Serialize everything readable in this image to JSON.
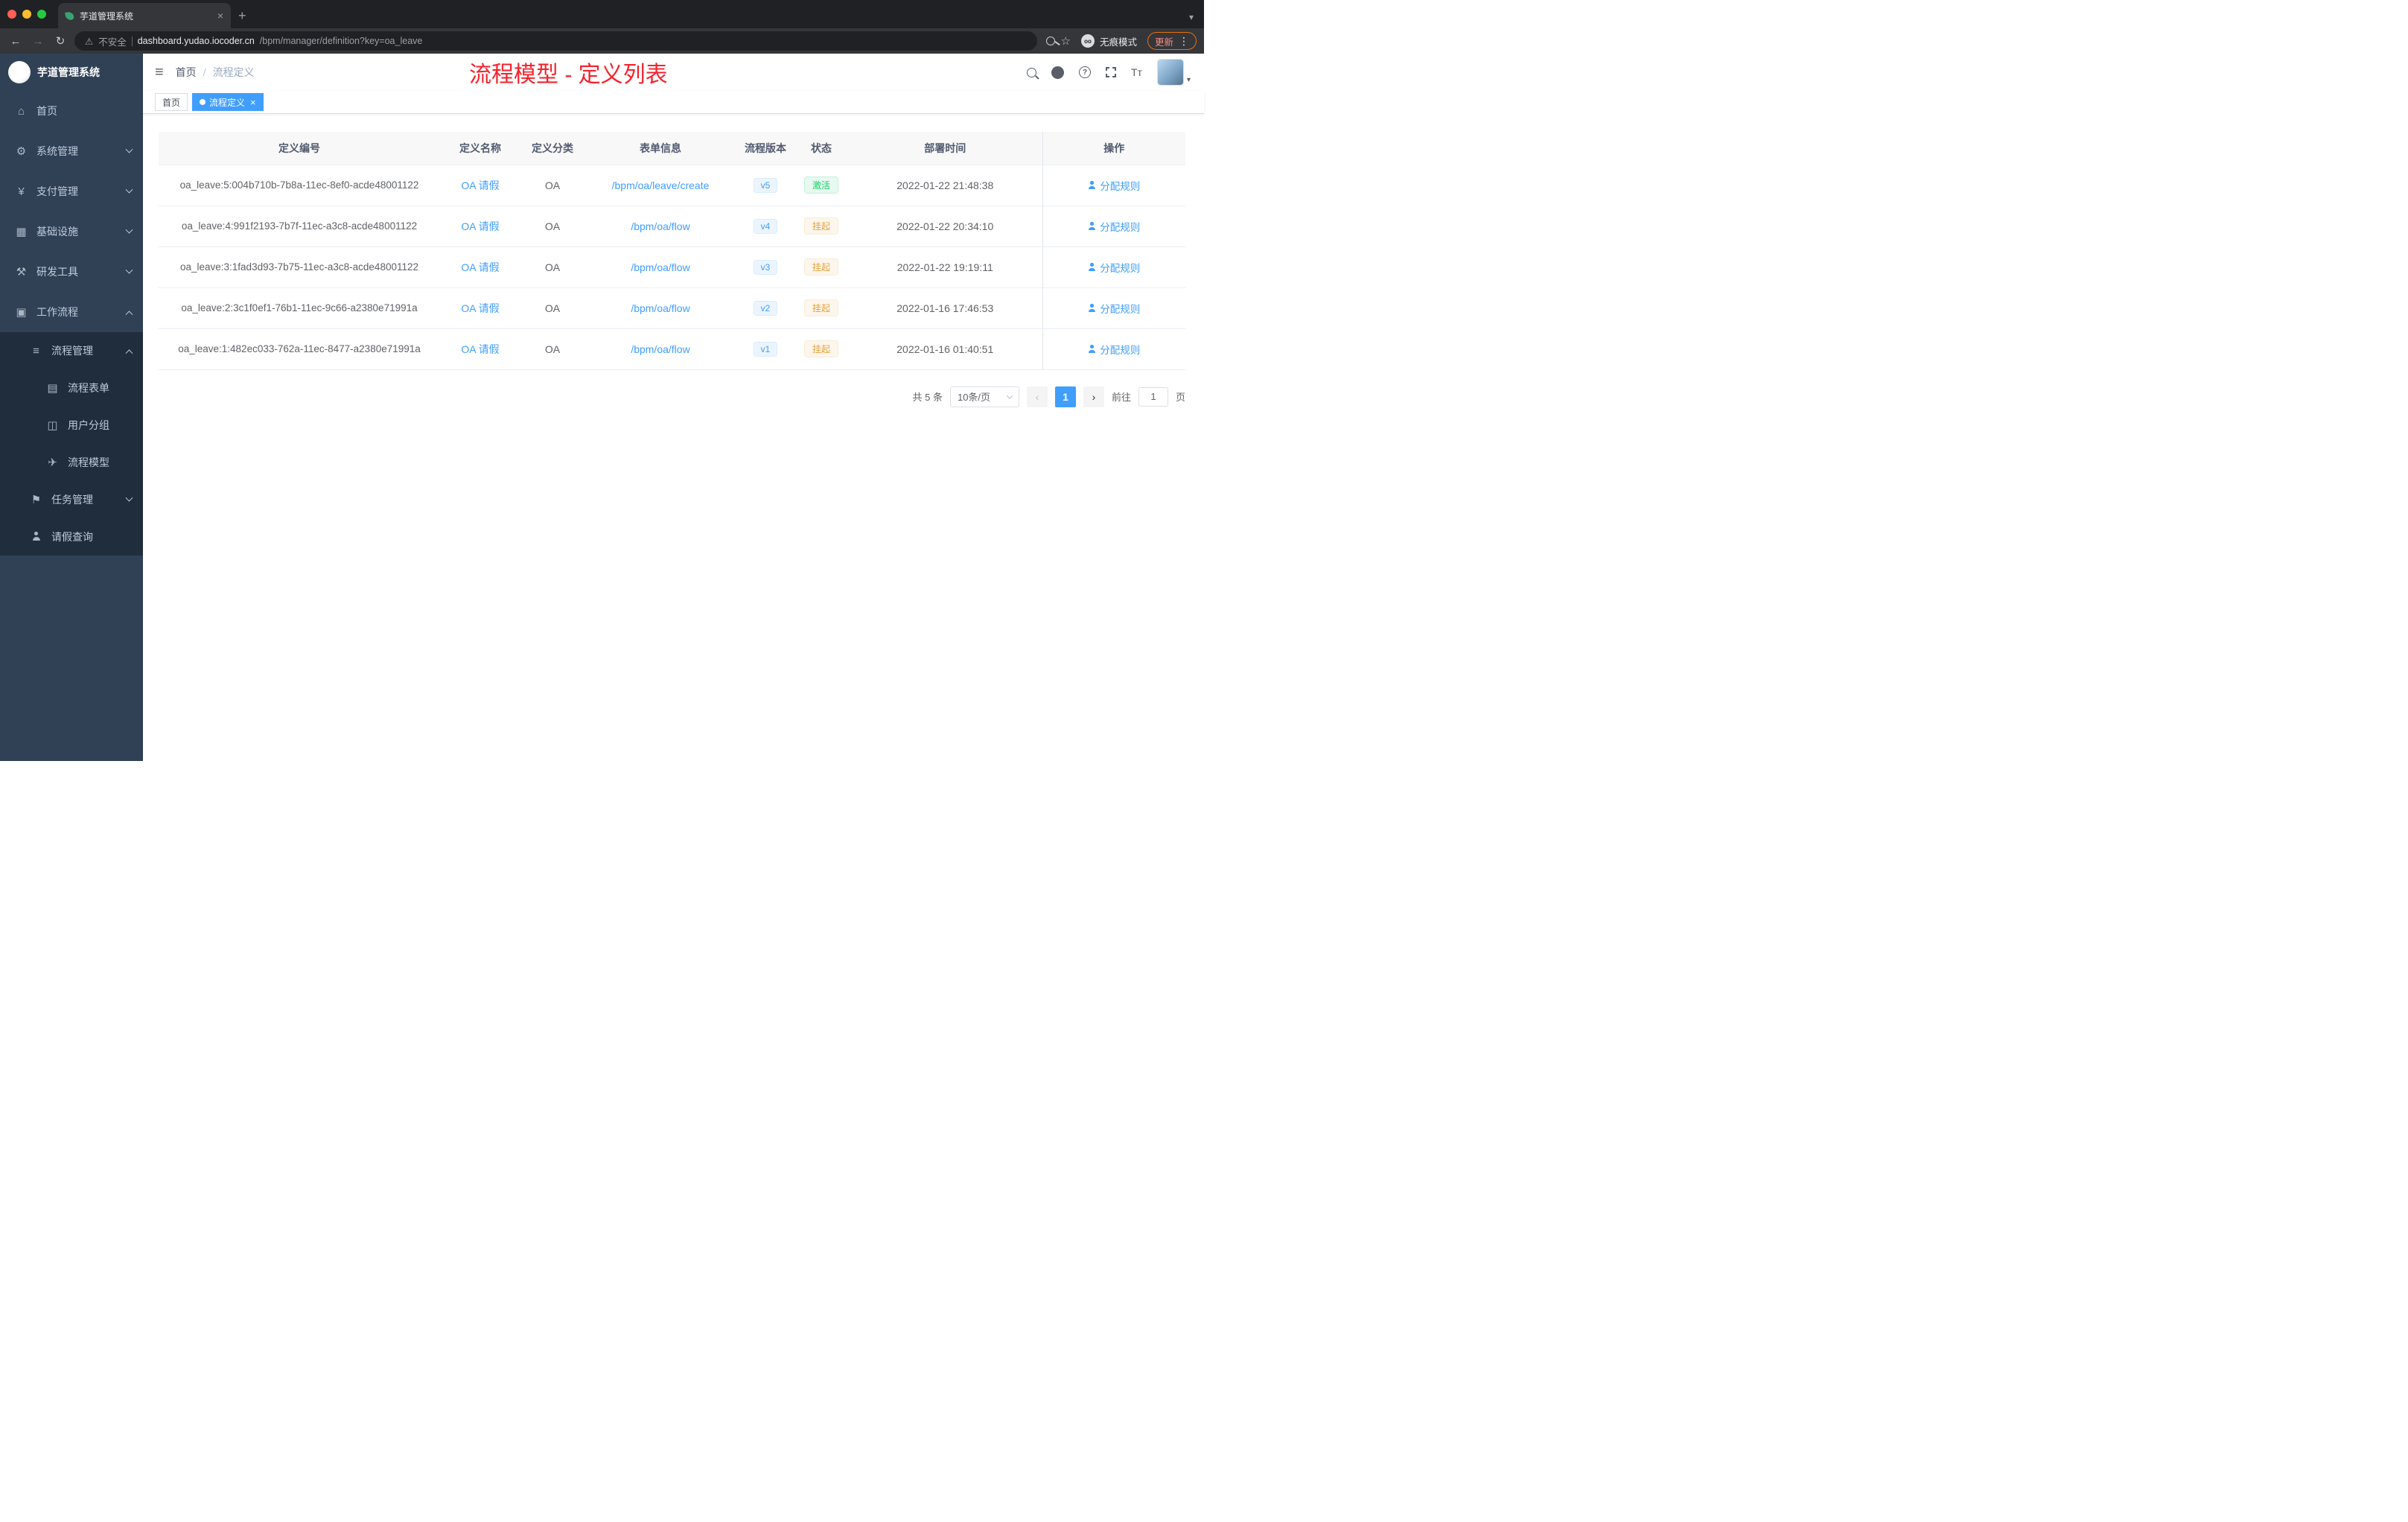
{
  "browser": {
    "tab_title": "芋道管理系统",
    "security_label": "不安全",
    "url_host": "dashboard.yudao.iocoder.cn",
    "url_path": "/bpm/manager/definition?key=oa_leave",
    "incognito_label": "无痕模式",
    "update_label": "更新"
  },
  "icons": {
    "close": "×",
    "plus": "+",
    "back": "←",
    "forward": "→",
    "reload": "↻",
    "warning": "⚠",
    "star": "☆",
    "menu_dots": "⋮",
    "hamburger": "≡",
    "question": "?",
    "font_size": "Tт",
    "chevron_left": "‹",
    "chevron_right": "›",
    "breadcrumb_sep": "/",
    "caret_down": "▾",
    "incognito_glasses": "oo"
  },
  "colors": {
    "accent": "#409eff",
    "annotation_red": "#f5222d",
    "status_active_green": "#13ce66",
    "status_suspend_orange": "#e6a23c",
    "sidebar_bg": "#304156",
    "submenu_bg": "#1f2d3d"
  },
  "sidebar": {
    "brand": "芋道管理系统",
    "items": [
      {
        "label": "首页",
        "icon": "⌂"
      },
      {
        "label": "系统管理",
        "icon": "⚙"
      },
      {
        "label": "支付管理",
        "icon": "¥"
      },
      {
        "label": "基础设施",
        "icon": "▦"
      },
      {
        "label": "研发工具",
        "icon": "⚒"
      },
      {
        "label": "工作流程",
        "icon": "▣"
      },
      {
        "label": "流程管理",
        "icon": "≡"
      },
      {
        "label": "流程表单",
        "icon": "▤"
      },
      {
        "label": "用户分组",
        "icon": "◫"
      },
      {
        "label": "流程模型",
        "icon": "✈"
      },
      {
        "label": "任务管理",
        "icon": "⚑"
      },
      {
        "label": "请假查询",
        "icon": ""
      }
    ]
  },
  "header": {
    "breadcrumb": [
      "首页",
      "流程定义"
    ],
    "annotation": "流程模型 - 定义列表"
  },
  "tags": {
    "items": [
      {
        "label": "首页"
      },
      {
        "label": "流程定义"
      }
    ]
  },
  "table": {
    "headers": [
      "定义编号",
      "定义名称",
      "定义分类",
      "表单信息",
      "流程版本",
      "状态",
      "部署时间",
      "操作"
    ],
    "action_label": "分配规则",
    "rows": [
      {
        "id": "oa_leave:5:004b710b-7b8a-11ec-8ef0-acde48001122",
        "name": "OA 请假",
        "category": "OA",
        "form": "/bpm/oa/leave/create",
        "version": "v5",
        "status": "激活",
        "status_type": "success",
        "time": "2022-01-22 21:48:38"
      },
      {
        "id": "oa_leave:4:991f2193-7b7f-11ec-a3c8-acde48001122",
        "name": "OA 请假",
        "category": "OA",
        "form": "/bpm/oa/flow",
        "version": "v4",
        "status": "挂起",
        "status_type": "warning",
        "time": "2022-01-22 20:34:10"
      },
      {
        "id": "oa_leave:3:1fad3d93-7b75-11ec-a3c8-acde48001122",
        "name": "OA 请假",
        "category": "OA",
        "form": "/bpm/oa/flow",
        "version": "v3",
        "status": "挂起",
        "status_type": "warning",
        "time": "2022-01-22 19:19:11"
      },
      {
        "id": "oa_leave:2:3c1f0ef1-76b1-11ec-9c66-a2380e71991a",
        "name": "OA 请假",
        "category": "OA",
        "form": "/bpm/oa/flow",
        "version": "v2",
        "status": "挂起",
        "status_type": "warning",
        "time": "2022-01-16 17:46:53"
      },
      {
        "id": "oa_leave:1:482ec033-762a-11ec-8477-a2380e71991a",
        "name": "OA 请假",
        "category": "OA",
        "form": "/bpm/oa/flow",
        "version": "v1",
        "status": "挂起",
        "status_type": "warning",
        "time": "2022-01-16 01:40:51"
      }
    ]
  },
  "pagination": {
    "total": "共 5 条",
    "page_size": "10条/页",
    "current_page": "1",
    "goto_label": "前往",
    "goto_value": "1",
    "page_suffix": "页"
  }
}
